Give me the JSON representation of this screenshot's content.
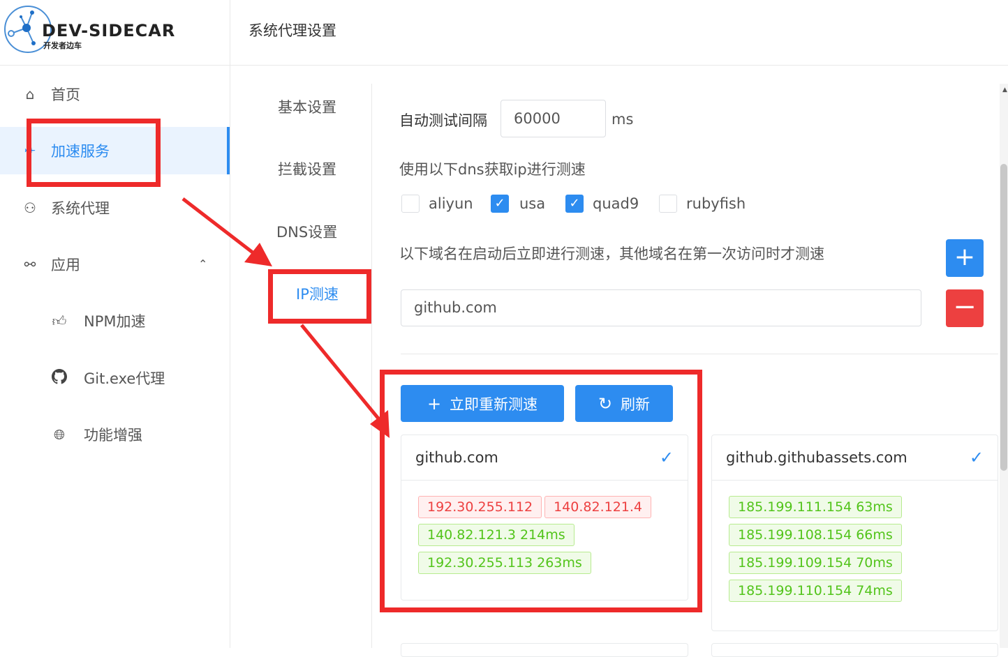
{
  "logo": {
    "title": "DEV-SIDECAR",
    "subtitle": "开发者边车"
  },
  "header": {
    "title": "系统代理设置"
  },
  "sidebar": {
    "items": [
      {
        "label": "首页",
        "icon": "home-icon"
      },
      {
        "label": "加速服务",
        "icon": "rocket-icon",
        "active": true
      },
      {
        "label": "系统代理",
        "icon": "network-icon"
      },
      {
        "label": "应用",
        "icon": "link-icon",
        "expanded": true
      },
      {
        "label": "NPM加速",
        "icon": "thumbs-up-icon"
      },
      {
        "label": "Git.exe代理",
        "icon": "github-icon"
      },
      {
        "label": "功能增强",
        "icon": "globe-icon"
      }
    ]
  },
  "tabs": [
    {
      "label": "基本设置"
    },
    {
      "label": "拦截设置"
    },
    {
      "label": "DNS设置"
    },
    {
      "label": "IP测速",
      "active": true
    }
  ],
  "form": {
    "interval_label": "自动测试间隔",
    "interval_value": "60000",
    "interval_unit": "ms",
    "dns_label": "使用以下dns获取ip进行测速",
    "dns_options": [
      {
        "label": "aliyun",
        "checked": false
      },
      {
        "label": "usa",
        "checked": true
      },
      {
        "label": "quad9",
        "checked": true
      },
      {
        "label": "rubyfish",
        "checked": false
      }
    ],
    "domains_label": "以下域名在启动后立即进行测速，其他域名在第一次访问时才测速",
    "domain_value": "github.com"
  },
  "actions": {
    "retest_label": "立即重新测速",
    "refresh_label": "刷新"
  },
  "results": [
    {
      "domain": "github.com",
      "ips": [
        {
          "text": "192.30.255.112",
          "status": "bad"
        },
        {
          "text": "140.82.121.4",
          "status": "bad"
        },
        {
          "text": "140.82.121.3 214ms",
          "status": "ok"
        },
        {
          "text": "192.30.255.113 263ms",
          "status": "ok"
        }
      ]
    },
    {
      "domain": "github.githubassets.com",
      "ips": [
        {
          "text": "185.199.111.154 63ms",
          "status": "ok"
        },
        {
          "text": "185.199.108.154 66ms",
          "status": "ok"
        },
        {
          "text": "185.199.109.154 70ms",
          "status": "ok"
        },
        {
          "text": "185.199.110.154 74ms",
          "status": "ok"
        }
      ]
    }
  ],
  "colors": {
    "primary": "#2d8cf0",
    "danger": "#ed4040",
    "annotation": "#ee2a2a",
    "success": "#52c41a"
  }
}
